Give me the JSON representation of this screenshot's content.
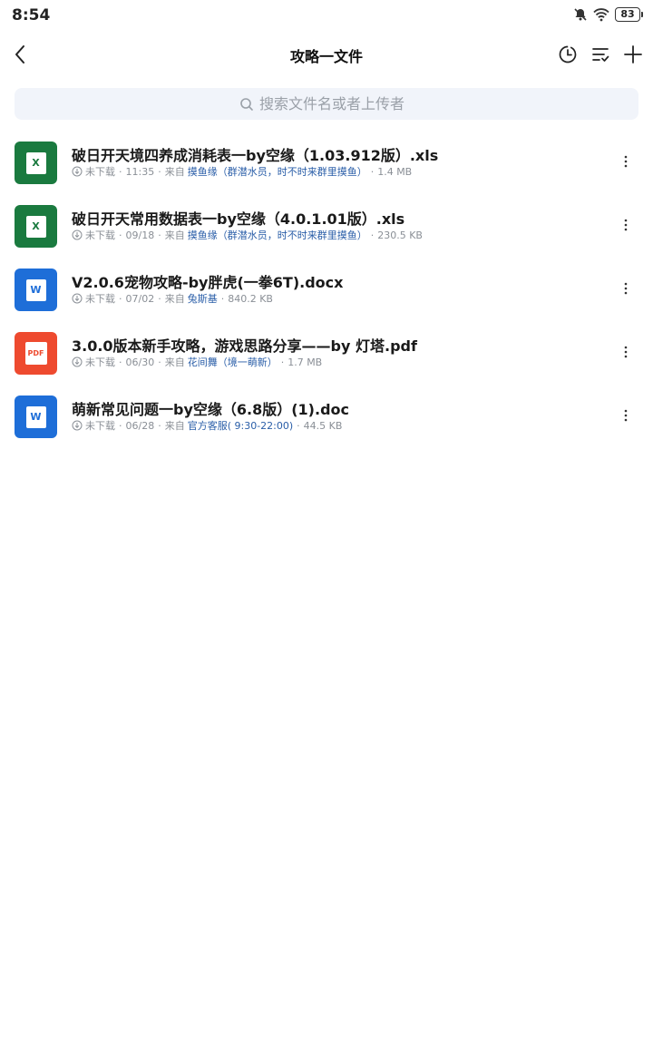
{
  "status_bar": {
    "time": "8:54",
    "battery": "83"
  },
  "nav": {
    "title": "攻略一文件"
  },
  "search": {
    "placeholder": "搜索文件名或者上传者"
  },
  "files": [
    {
      "name": "破日开天境四养成消耗表一by空缘（1.03.912版）.xls",
      "type": "xls",
      "icon_label": "X",
      "status": "未下载",
      "date": "11:35",
      "from_label": "来自",
      "uploader": "摸鱼缘（群潜水员，时不时来群里摸鱼）",
      "size": "1.4 MB"
    },
    {
      "name": "破日开天常用数据表一by空缘（4.0.1.01版）.xls",
      "type": "xls",
      "icon_label": "X",
      "status": "未下载",
      "date": "09/18",
      "from_label": "来自",
      "uploader": "摸鱼缘（群潜水员，时不时来群里摸鱼）",
      "size": "230.5 KB"
    },
    {
      "name": "V2.0.6宠物攻略-by胖虎(一拳6T).docx",
      "type": "doc",
      "icon_label": "W",
      "status": "未下载",
      "date": "07/02",
      "from_label": "来自",
      "uploader": "兔斯基",
      "size": "840.2 KB"
    },
    {
      "name": "3.0.0版本新手攻略，游戏思路分享——by 灯塔.pdf",
      "type": "pdf",
      "icon_label": "PDF",
      "status": "未下载",
      "date": "06/30",
      "from_label": "来自",
      "uploader": "花间舞（境一萌新）",
      "size": "1.7 MB"
    },
    {
      "name": "萌新常见问题一by空缘（6.8版）(1).doc",
      "type": "doc",
      "icon_label": "W",
      "status": "未下载",
      "date": "06/28",
      "from_label": "来自",
      "uploader": "官方客服( 9:30-22:00)",
      "size": "44.5 KB"
    }
  ],
  "colors": {
    "xls": "#1a7a3f",
    "doc": "#1e6ed8",
    "pdf": "#ee4a2f",
    "uploader": "#2a5ea8",
    "search_bg": "#f1f4fa"
  }
}
